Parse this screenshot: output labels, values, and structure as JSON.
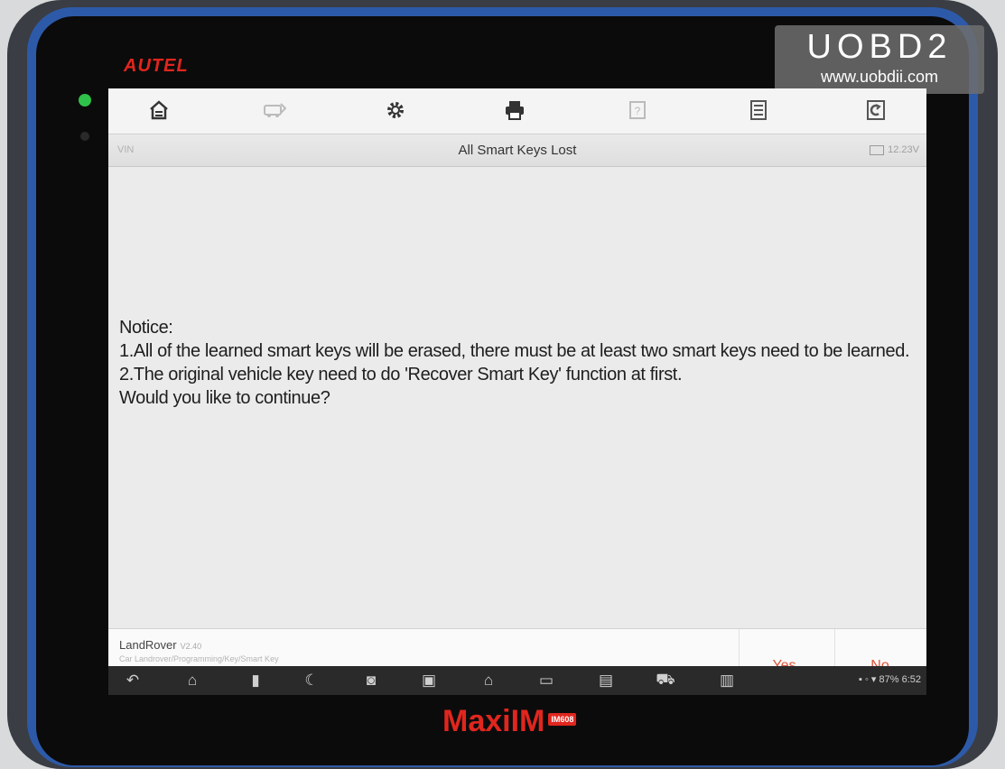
{
  "device": {
    "brand": "AUTEL",
    "model": "MaxiIM",
    "model_badge": "IM608"
  },
  "watermark": {
    "title": "UOBD2",
    "url": "www.uobdii.com"
  },
  "toolbar": {
    "items": [
      {
        "icon": "home-icon",
        "glyph": "⌂"
      },
      {
        "icon": "vehicle-swap-icon",
        "glyph": "⇄"
      },
      {
        "icon": "gear-icon",
        "glyph": "⚙"
      },
      {
        "icon": "printer-icon",
        "glyph": "⎙"
      },
      {
        "icon": "help-icon",
        "glyph": "?"
      },
      {
        "icon": "save-icon",
        "glyph": "▤"
      },
      {
        "icon": "exit-icon",
        "glyph": "⎋"
      }
    ]
  },
  "titlebar": {
    "vin": "VIN",
    "title": "All Smart Keys Lost",
    "voltage": "12.23V"
  },
  "notice": {
    "heading": "Notice:",
    "line1": "1.All of the learned smart keys will be erased, there must be at least two smart keys need to be learned.",
    "line2": "2.The original vehicle key need to do 'Recover Smart Key' function at first.",
    "line3": "Would you like to continue?"
  },
  "footer": {
    "make": "LandRover",
    "version": "V2.40",
    "path": "Car Landrover/Programming/Key/Smart Key",
    "yes_label": "Yes",
    "no_label": "No"
  },
  "navbar": {
    "status_text": "87% 6:52"
  }
}
